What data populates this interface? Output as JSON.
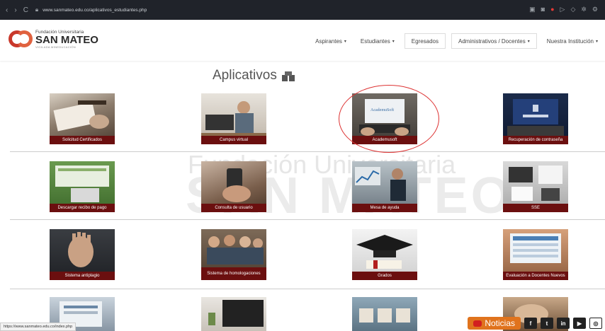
{
  "browser": {
    "url": "www.sanmateo.edu.co/aplicativos_estudiantes.php",
    "nav": {
      "back": "‹",
      "forward": "›",
      "reload": "C"
    },
    "status_url": "https://www.sanmateo.edu.co/index.php"
  },
  "header": {
    "logo_line1": "Fundación Universitaria",
    "logo_line2": "SAN MATEO",
    "logo_line3": "VIGILADA MINEDUCACIÓN",
    "menu": [
      {
        "label": "Aspirantes",
        "caret": "▾"
      },
      {
        "label": "Estudiantes",
        "caret": "▾"
      },
      {
        "label": "Egresados",
        "caret": ""
      },
      {
        "label": "Administrativos / Docentes",
        "caret": "▾"
      },
      {
        "label": "Nuestra Institución",
        "caret": "▾"
      }
    ]
  },
  "watermark": {
    "line1": "Fundación Universitaria",
    "line2": "SAN MATEO"
  },
  "section": {
    "title": "Aplicativos"
  },
  "tiles": [
    {
      "label": "Solicitud Certificados"
    },
    {
      "label": "Campus virtual"
    },
    {
      "label": "Academusoft",
      "screen_text": "AcademuSoft"
    },
    {
      "label": "Recuperación de contraseña"
    },
    {
      "label": "Descargar recibo de pago"
    },
    {
      "label": "Consulta de usuario"
    },
    {
      "label": "Mesa de ayuda"
    },
    {
      "label": "SSE"
    },
    {
      "label": "Sistema antiplagio"
    },
    {
      "label": "Sistema de homologaciones"
    },
    {
      "label": "Grados"
    },
    {
      "label": "Evaluación a Docentes Nuevos"
    },
    {
      "label": ""
    },
    {
      "label": ""
    },
    {
      "label": ""
    },
    {
      "label": ""
    }
  ],
  "social": {
    "noticias": "Noticias",
    "icons": [
      {
        "name": "facebook",
        "glyph": "f"
      },
      {
        "name": "twitter",
        "glyph": "t"
      },
      {
        "name": "linkedin",
        "glyph": "in"
      },
      {
        "name": "youtube",
        "glyph": "▶"
      },
      {
        "name": "instagram",
        "glyph": "◎"
      }
    ]
  },
  "colors": {
    "caption_bg": "#6b0f0f",
    "logo_red": "#c9382b",
    "noticias_orange": "#e0731d",
    "annotation_red": "#dd3333"
  }
}
